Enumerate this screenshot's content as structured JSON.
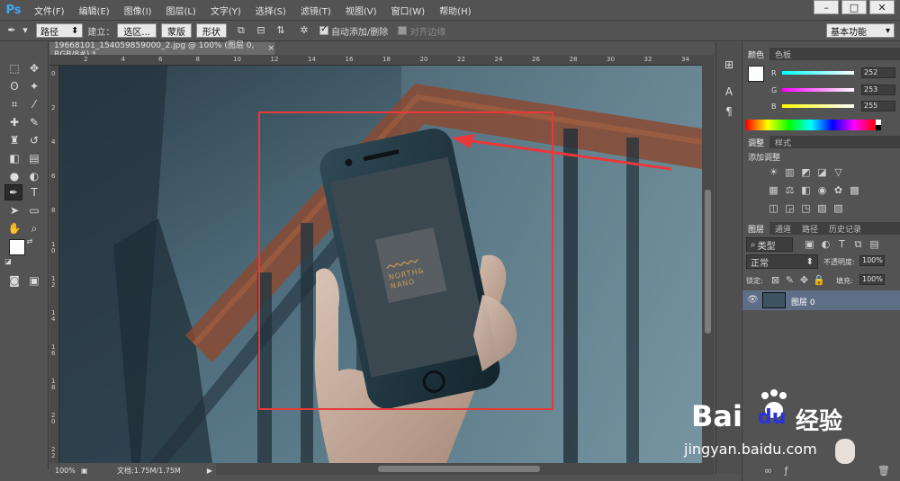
{
  "app": {
    "logo": "Ps",
    "window_min": "–",
    "window_max": "□",
    "window_close": "✕"
  },
  "menu": [
    "文件(F)",
    "编辑(E)",
    "图像(I)",
    "图层(L)",
    "文字(Y)",
    "选择(S)",
    "滤镜(T)",
    "视图(V)",
    "窗口(W)",
    "帮助(H)"
  ],
  "options": {
    "tool_mode": "路径",
    "make_label": "建立：",
    "selection_btn": "选区...",
    "mask_btn": "蒙版",
    "shape_btn": "形状",
    "auto_add_delete": "自动添加/删除",
    "auto_add_checked": true,
    "align_edges": "对齐边缘",
    "align_checked": false,
    "workspace": "基本功能"
  },
  "document": {
    "tab_title": "19668101_154059859000_2.jpg @ 100% (图层 0, RGB/8#) *",
    "tab_close": "×",
    "zoom": "100%",
    "doc_info": "文档:1.75M/1.75M",
    "phone_brand_line1": "NORTH&",
    "phone_brand_line2": "NANO"
  },
  "ruler_h": [
    "2",
    "4",
    "6",
    "8",
    "10",
    "12",
    "14",
    "16",
    "18",
    "20",
    "22",
    "24",
    "26",
    "28",
    "30",
    "32",
    "34"
  ],
  "ruler_v": [
    "0",
    "2",
    "4",
    "6",
    "8",
    "1\n0",
    "1\n2",
    "1\n4",
    "1\n6",
    "1\n8",
    "2\n0",
    "2\n2"
  ],
  "color_panel": {
    "tabs": [
      "颜色",
      "色板"
    ],
    "r_label": "R",
    "g_label": "G",
    "b_label": "B",
    "r": "252",
    "g": "253",
    "b": "255",
    "fg": "#fcfdff"
  },
  "adjust_panel": {
    "tabs": [
      "调整",
      "样式"
    ],
    "title": "添加调整"
  },
  "layers_panel": {
    "tabs": [
      "图层",
      "通道",
      "路径",
      "历史记录"
    ],
    "filter_kind": "类型",
    "blend_mode": "正常",
    "opacity_label": "不透明度:",
    "opacity": "100%",
    "lock_label": "锁定:",
    "fill_label": "填充:",
    "fill": "100%",
    "layer_name": "图层 0"
  },
  "watermark": {
    "brand": "Bai",
    "brand2": "du",
    "brand3": "经验",
    "url": "jingyan.baidu.com"
  },
  "colors": {
    "accent": "#3fa9f5",
    "highlight_box": "#e8393a",
    "ui_bg": "#535353"
  }
}
